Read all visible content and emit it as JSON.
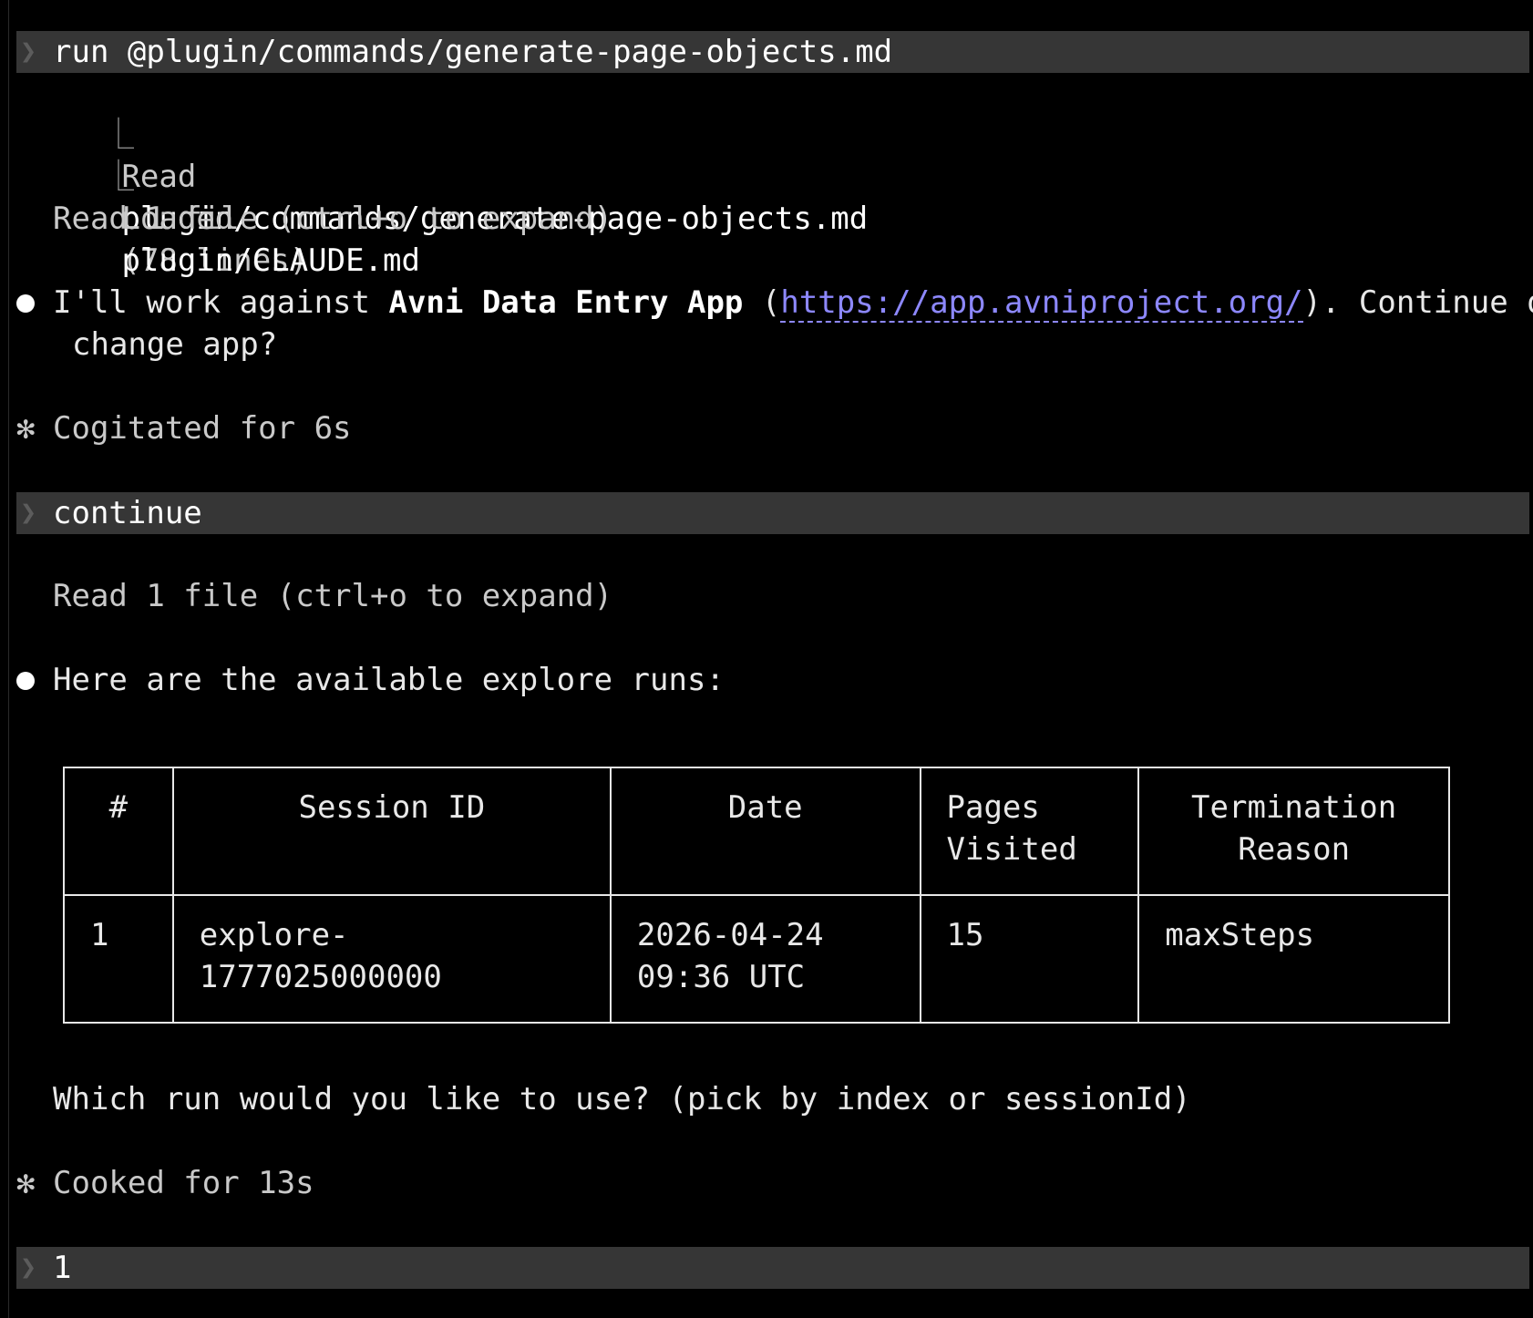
{
  "prompt1": {
    "chevron": "❯",
    "text": "run @plugin/commands/generate-page-objects.md"
  },
  "tool_lines": [
    {
      "prefix": "⎿",
      "verb": "Read",
      "path": "plugin/commands/generate-page-objects.md",
      "suffix": "(78 lines)"
    },
    {
      "prefix": "⎿",
      "verb": "Loaded",
      "path": "plugin/CLAUDE.md",
      "suffix": ""
    }
  ],
  "read_summary_1": "Read 1 file (ctrl+o to expand)",
  "message1": {
    "before": "I'll work against ",
    "app_name": "Avni Data Entry App",
    "open_paren": " (",
    "url": "https://app.avniproject.org/",
    "after": "). Continue or",
    "line2": "change app?"
  },
  "status1": {
    "icon": "✻",
    "text": "Cogitated for 6s"
  },
  "prompt2": {
    "chevron": "❯",
    "text": "continue"
  },
  "read_summary_2": "Read 1 file (ctrl+o to expand)",
  "message2": "Here are the available explore runs:",
  "table": {
    "headers": [
      "#",
      "Session ID",
      "Date",
      "Pages\nVisited",
      "Termination\nReason"
    ],
    "rows": [
      [
        "1",
        "explore-1777025000000",
        "2026-04-24\n09:36 UTC",
        "15",
        "maxSteps"
      ]
    ]
  },
  "question": "Which run would you like to use? (pick by index or sessionId)",
  "status2": {
    "icon": "✻",
    "text": "Cooked for 13s"
  },
  "prompt3": {
    "chevron": "❯",
    "text": "1"
  },
  "colors": {
    "background": "#000000",
    "prompt_bar": "#363636",
    "link": "#8d88ff",
    "text": "#e8e8e8"
  }
}
